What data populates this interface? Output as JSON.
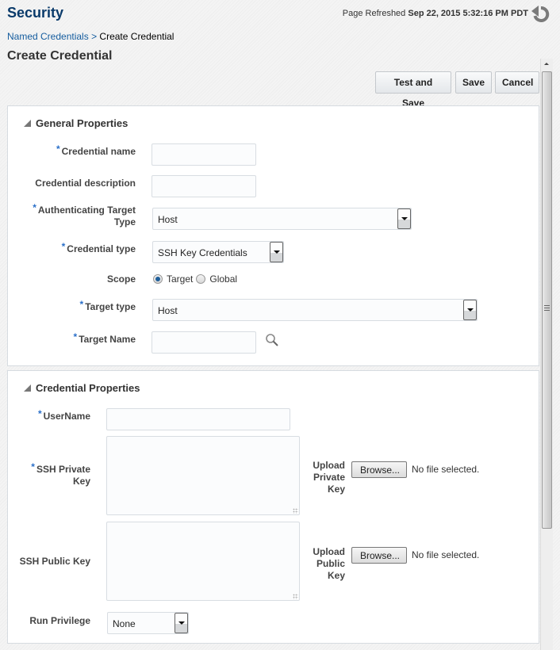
{
  "header": {
    "title": "Security",
    "refresh_prefix": "Page Refreshed",
    "refresh_time": "Sep 22, 2015 5:32:16 PM PDT",
    "refresh_icon": "refresh-icon"
  },
  "breadcrumb": {
    "parent": "Named Credentials",
    "separator": ">",
    "current": "Create Credential"
  },
  "page": {
    "subtitle": "Create Credential"
  },
  "toolbar": {
    "test_and_save_label": "Test and Save",
    "save_label": "Save",
    "cancel_label": "Cancel"
  },
  "general": {
    "title": "General Properties",
    "credential_name": {
      "label": "Credential name",
      "required": true,
      "value": ""
    },
    "credential_description": {
      "label": "Credential description",
      "required": false,
      "value": ""
    },
    "authenticating_target_type": {
      "label_line1": "Authenticating Target",
      "label_line2": "Type",
      "required": true,
      "value": "Host"
    },
    "credential_type": {
      "label": "Credential type",
      "required": true,
      "value": "SSH Key Credentials"
    },
    "scope": {
      "label": "Scope",
      "options": [
        "Target",
        "Global"
      ],
      "selected": "Target"
    },
    "target_type": {
      "label": "Target type",
      "required": true,
      "value": "Host"
    },
    "target_name": {
      "label": "Target Name",
      "required": true,
      "value": "",
      "search_icon": "search-icon"
    }
  },
  "credential": {
    "title": "Credential Properties",
    "username": {
      "label": "UserName",
      "required": true,
      "value": ""
    },
    "ssh_private_key": {
      "label_line1": "SSH Private",
      "label_line2": "Key",
      "required": true,
      "value": "",
      "upload_label": [
        "Upload",
        "Private",
        "Key"
      ],
      "browse_label": "Browse...",
      "file_status": "No file selected."
    },
    "ssh_public_key": {
      "label": "SSH Public Key",
      "required": false,
      "value": "",
      "upload_label": [
        "Upload",
        "Public",
        "Key"
      ],
      "browse_label": "Browse...",
      "file_status": "No file selected."
    },
    "run_privilege": {
      "label": "Run Privilege",
      "value": "None"
    }
  },
  "required_marker": "*",
  "colors": {
    "title": "#0a3a6a",
    "link": "#145c9e",
    "required": "#2a6fc9"
  }
}
